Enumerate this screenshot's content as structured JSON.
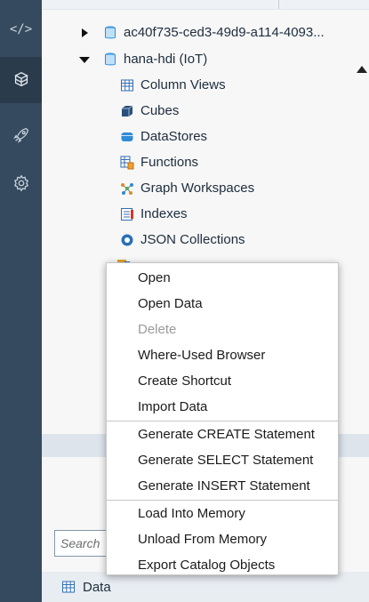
{
  "activity_bar": {
    "items": [
      {
        "icon": "code-icon",
        "active": false
      },
      {
        "icon": "database-explorer-icon",
        "active": true
      },
      {
        "icon": "rocket-icon",
        "active": false
      },
      {
        "icon": "settings-icon",
        "active": false
      }
    ],
    "code_glyph": "</>"
  },
  "tree": {
    "items": [
      {
        "label": "ac40f735-ced3-49d9-a114-4093...",
        "icon": "hdi-container-icon",
        "expanded": false
      },
      {
        "label": "hana-hdi (IoT)",
        "icon": "hdi-container-icon",
        "expanded": true
      },
      {
        "label": "Column Views",
        "icon": "column-view-icon"
      },
      {
        "label": "Cubes",
        "icon": "cube-icon"
      },
      {
        "label": "DataStores",
        "icon": "datastore-icon"
      },
      {
        "label": "Functions",
        "icon": "function-icon"
      },
      {
        "label": "Graph Workspaces",
        "icon": "graph-workspace-icon"
      },
      {
        "label": "Indexes",
        "icon": "index-icon"
      },
      {
        "label": "JSON Collections",
        "icon": "json-collection-icon"
      }
    ]
  },
  "search": {
    "placeholder": "Search"
  },
  "bottom_tab": {
    "label": "Data",
    "icon": "table-icon"
  },
  "context_menu": {
    "groups": [
      [
        {
          "label": "Open",
          "enabled": true
        },
        {
          "label": "Open Data",
          "enabled": true
        },
        {
          "label": "Delete",
          "enabled": false
        },
        {
          "label": "Where-Used Browser",
          "enabled": true
        },
        {
          "label": "Create Shortcut",
          "enabled": true
        },
        {
          "label": "Import Data",
          "enabled": true
        }
      ],
      [
        {
          "label": "Generate CREATE Statement",
          "enabled": true
        },
        {
          "label": "Generate SELECT Statement",
          "enabled": true
        },
        {
          "label": "Generate INSERT Statement",
          "enabled": true
        }
      ],
      [
        {
          "label": "Load Into Memory",
          "enabled": true
        },
        {
          "label": "Unload From Memory",
          "enabled": true
        },
        {
          "label": "Export Catalog Objects",
          "enabled": true
        }
      ]
    ]
  },
  "colors": {
    "activity_bar_bg": "#354a5f",
    "activity_bar_active": "#2a3b4c",
    "container_blue": "#2f8bd6",
    "highlight": "#dde4ec"
  }
}
